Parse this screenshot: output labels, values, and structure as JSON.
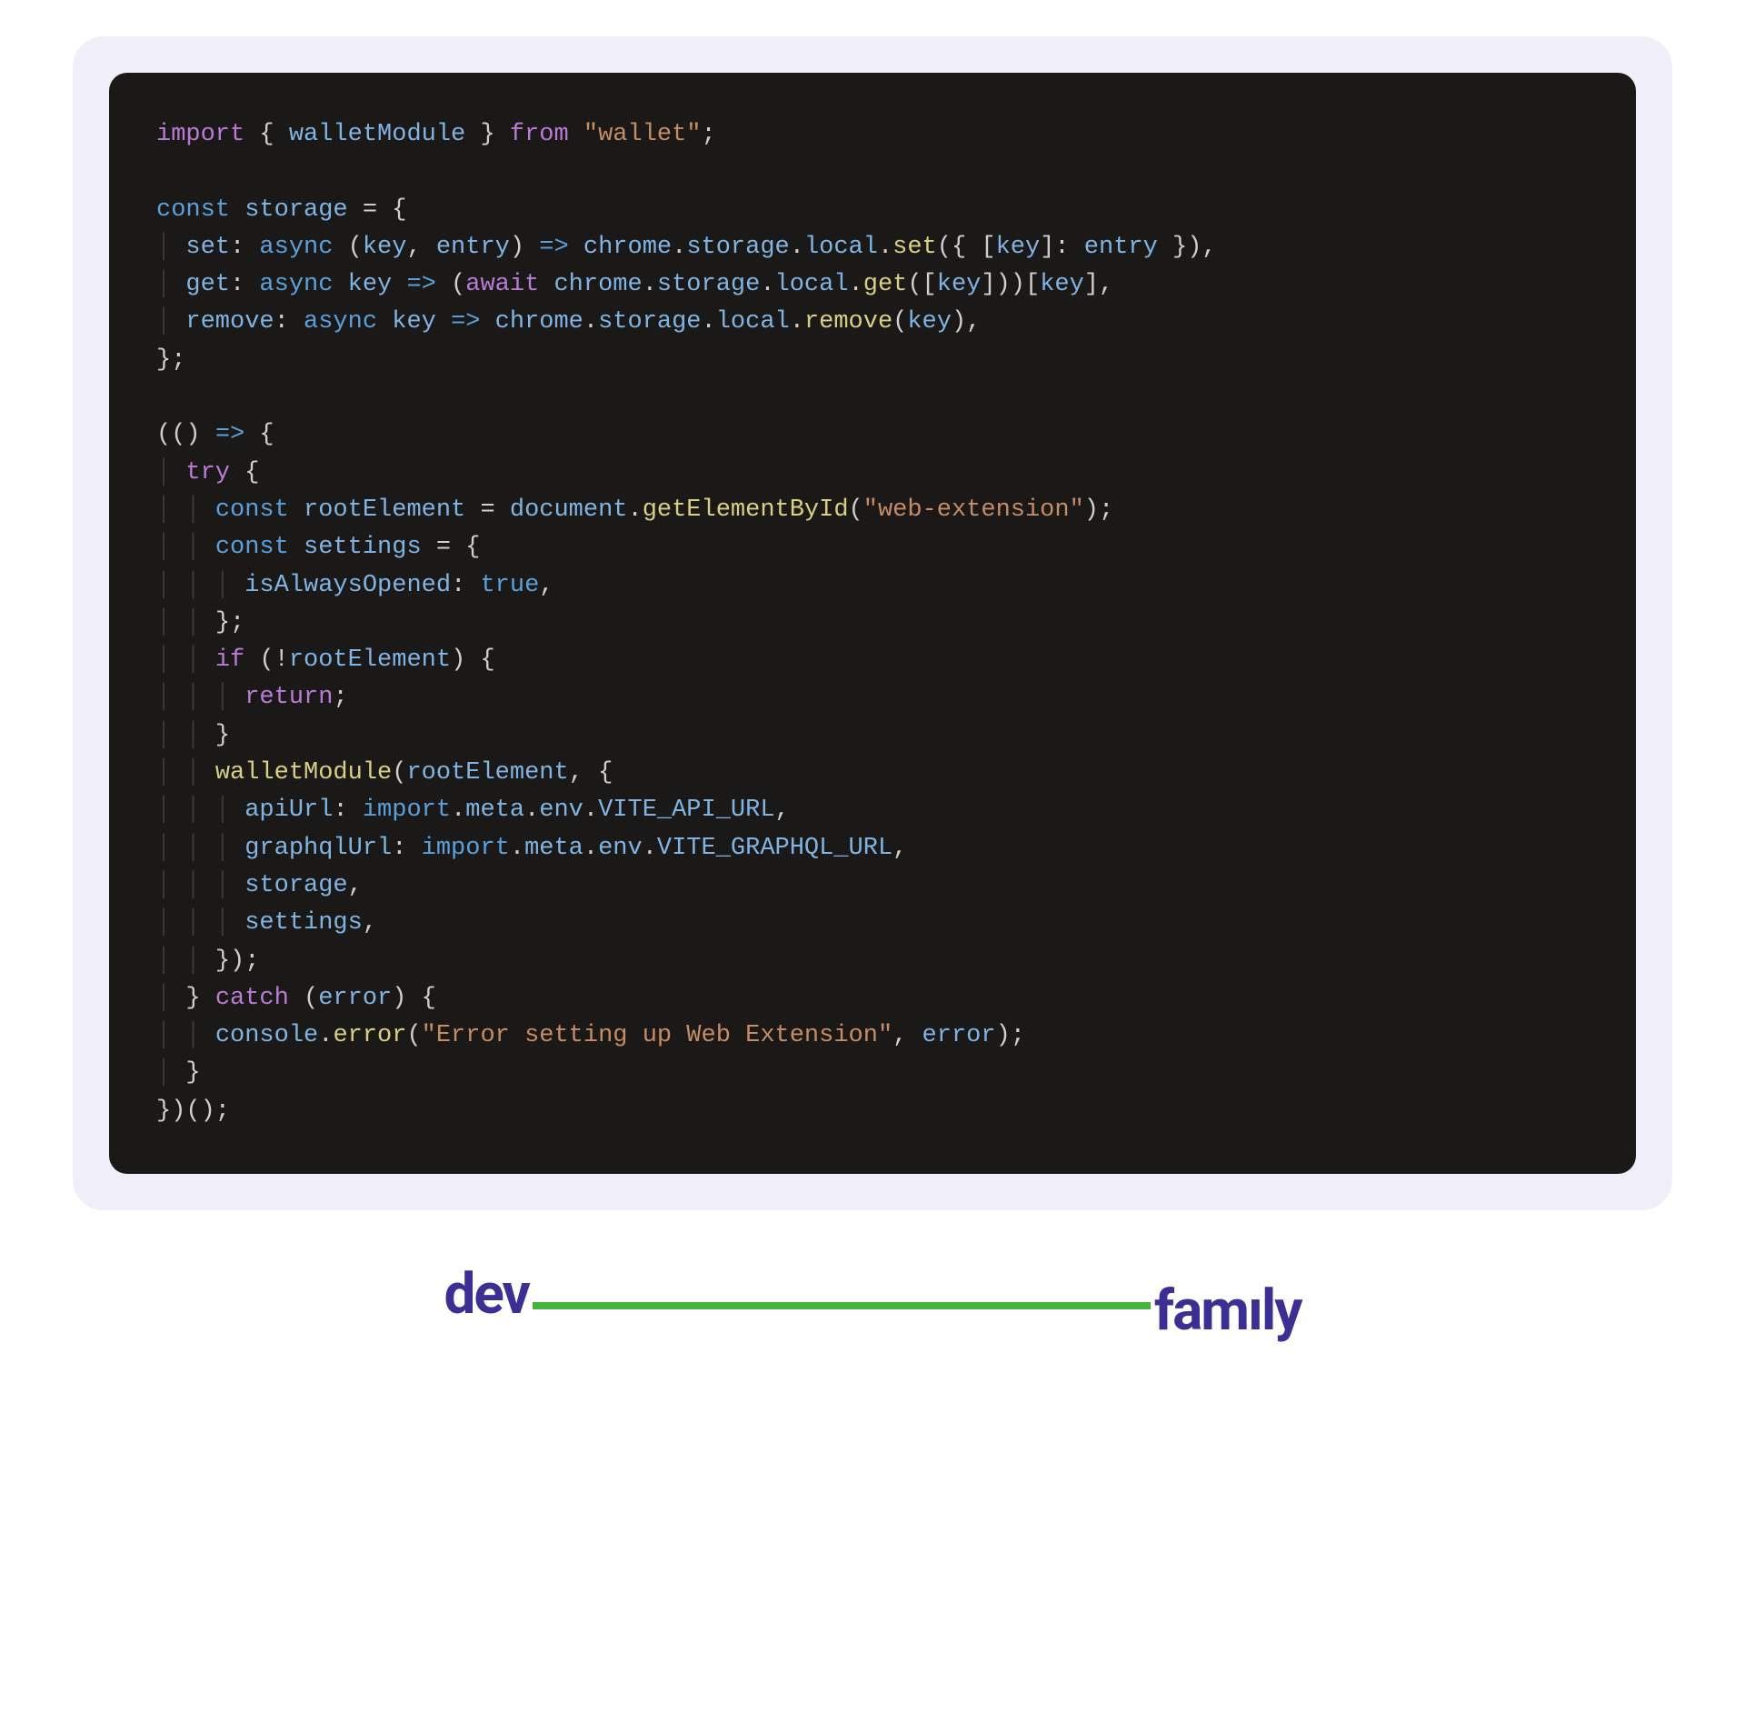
{
  "code": {
    "tokens": [
      [
        [
          "t-purple",
          "import"
        ],
        [
          "t-op",
          " { "
        ],
        [
          "t-lblue",
          "walletModule"
        ],
        [
          "t-op",
          " } "
        ],
        [
          "t-purple",
          "from"
        ],
        [
          "t-op",
          " "
        ],
        [
          "t-string",
          "\"wallet\""
        ],
        [
          "t-op",
          ";"
        ]
      ],
      [],
      [
        [
          "t-blue",
          "const"
        ],
        [
          "t-op",
          " "
        ],
        [
          "t-lblue",
          "storage"
        ],
        [
          "t-op",
          " = {"
        ]
      ],
      [
        [
          "indent-guide",
          "│ "
        ],
        [
          "t-lblue",
          "set"
        ],
        [
          "t-op",
          ": "
        ],
        [
          "t-blue",
          "async"
        ],
        [
          "t-op",
          " ("
        ],
        [
          "t-lblue",
          "key"
        ],
        [
          "t-op",
          ", "
        ],
        [
          "t-lblue",
          "entry"
        ],
        [
          "t-op",
          ") "
        ],
        [
          "t-blue",
          "=>"
        ],
        [
          "t-op",
          " "
        ],
        [
          "t-lblue",
          "chrome"
        ],
        [
          "t-op",
          "."
        ],
        [
          "t-lblue",
          "storage"
        ],
        [
          "t-op",
          "."
        ],
        [
          "t-lblue",
          "local"
        ],
        [
          "t-op",
          "."
        ],
        [
          "t-fn",
          "set"
        ],
        [
          "t-op",
          "({ ["
        ],
        [
          "t-lblue",
          "key"
        ],
        [
          "t-op",
          "]: "
        ],
        [
          "t-lblue",
          "entry"
        ],
        [
          "t-op",
          " }),"
        ]
      ],
      [
        [
          "indent-guide",
          "│ "
        ],
        [
          "t-lblue",
          "get"
        ],
        [
          "t-op",
          ": "
        ],
        [
          "t-blue",
          "async"
        ],
        [
          "t-op",
          " "
        ],
        [
          "t-lblue",
          "key"
        ],
        [
          "t-op",
          " "
        ],
        [
          "t-blue",
          "=>"
        ],
        [
          "t-op",
          " ("
        ],
        [
          "t-purple",
          "await"
        ],
        [
          "t-op",
          " "
        ],
        [
          "t-lblue",
          "chrome"
        ],
        [
          "t-op",
          "."
        ],
        [
          "t-lblue",
          "storage"
        ],
        [
          "t-op",
          "."
        ],
        [
          "t-lblue",
          "local"
        ],
        [
          "t-op",
          "."
        ],
        [
          "t-fn",
          "get"
        ],
        [
          "t-op",
          "(["
        ],
        [
          "t-lblue",
          "key"
        ],
        [
          "t-op",
          "]))["
        ],
        [
          "t-lblue",
          "key"
        ],
        [
          "t-op",
          "],"
        ]
      ],
      [
        [
          "indent-guide",
          "│ "
        ],
        [
          "t-lblue",
          "remove"
        ],
        [
          "t-op",
          ": "
        ],
        [
          "t-blue",
          "async"
        ],
        [
          "t-op",
          " "
        ],
        [
          "t-lblue",
          "key"
        ],
        [
          "t-op",
          " "
        ],
        [
          "t-blue",
          "=>"
        ],
        [
          "t-op",
          " "
        ],
        [
          "t-lblue",
          "chrome"
        ],
        [
          "t-op",
          "."
        ],
        [
          "t-lblue",
          "storage"
        ],
        [
          "t-op",
          "."
        ],
        [
          "t-lblue",
          "local"
        ],
        [
          "t-op",
          "."
        ],
        [
          "t-fn",
          "remove"
        ],
        [
          "t-op",
          "("
        ],
        [
          "t-lblue",
          "key"
        ],
        [
          "t-op",
          "),"
        ]
      ],
      [
        [
          "t-op",
          "};"
        ]
      ],
      [],
      [
        [
          "t-op",
          "(() "
        ],
        [
          "t-blue",
          "=>"
        ],
        [
          "t-op",
          " {"
        ]
      ],
      [
        [
          "indent-guide",
          "│ "
        ],
        [
          "t-purple",
          "try"
        ],
        [
          "t-op",
          " {"
        ]
      ],
      [
        [
          "indent-guide",
          "│ │ "
        ],
        [
          "t-blue",
          "const"
        ],
        [
          "t-op",
          " "
        ],
        [
          "t-lblue",
          "rootElement"
        ],
        [
          "t-op",
          " = "
        ],
        [
          "t-lblue",
          "document"
        ],
        [
          "t-op",
          "."
        ],
        [
          "t-fn",
          "getElementById"
        ],
        [
          "t-op",
          "("
        ],
        [
          "t-string",
          "\"web-extension\""
        ],
        [
          "t-op",
          ");"
        ]
      ],
      [
        [
          "indent-guide",
          "│ │ "
        ],
        [
          "t-blue",
          "const"
        ],
        [
          "t-op",
          " "
        ],
        [
          "t-lblue",
          "settings"
        ],
        [
          "t-op",
          " = {"
        ]
      ],
      [
        [
          "indent-guide",
          "│ │ │ "
        ],
        [
          "t-lblue",
          "isAlwaysOpened"
        ],
        [
          "t-op",
          ": "
        ],
        [
          "t-blue",
          "true"
        ],
        [
          "t-op",
          ","
        ]
      ],
      [
        [
          "indent-guide",
          "│ │ "
        ],
        [
          "t-op",
          "};"
        ]
      ],
      [
        [
          "indent-guide",
          "│ │ "
        ],
        [
          "t-purple",
          "if"
        ],
        [
          "t-op",
          " (!"
        ],
        [
          "t-lblue",
          "rootElement"
        ],
        [
          "t-op",
          ") {"
        ]
      ],
      [
        [
          "indent-guide",
          "│ │ │ "
        ],
        [
          "t-purple",
          "return"
        ],
        [
          "t-op",
          ";"
        ]
      ],
      [
        [
          "indent-guide",
          "│ │ "
        ],
        [
          "t-op",
          "}"
        ]
      ],
      [
        [
          "indent-guide",
          "│ │ "
        ],
        [
          "t-fn",
          "walletModule"
        ],
        [
          "t-op",
          "("
        ],
        [
          "t-lblue",
          "rootElement"
        ],
        [
          "t-op",
          ", {"
        ]
      ],
      [
        [
          "indent-guide",
          "│ │ │ "
        ],
        [
          "t-lblue",
          "apiUrl"
        ],
        [
          "t-op",
          ": "
        ],
        [
          "t-blue",
          "import"
        ],
        [
          "t-op",
          "."
        ],
        [
          "t-lblue",
          "meta"
        ],
        [
          "t-op",
          "."
        ],
        [
          "t-lblue",
          "env"
        ],
        [
          "t-op",
          "."
        ],
        [
          "t-lblue",
          "VITE_API_URL"
        ],
        [
          "t-op",
          ","
        ]
      ],
      [
        [
          "indent-guide",
          "│ │ │ "
        ],
        [
          "t-lblue",
          "graphqlUrl"
        ],
        [
          "t-op",
          ": "
        ],
        [
          "t-blue",
          "import"
        ],
        [
          "t-op",
          "."
        ],
        [
          "t-lblue",
          "meta"
        ],
        [
          "t-op",
          "."
        ],
        [
          "t-lblue",
          "env"
        ],
        [
          "t-op",
          "."
        ],
        [
          "t-lblue",
          "VITE_GRAPHQL_URL"
        ],
        [
          "t-op",
          ","
        ]
      ],
      [
        [
          "indent-guide",
          "│ │ │ "
        ],
        [
          "t-lblue",
          "storage"
        ],
        [
          "t-op",
          ","
        ]
      ],
      [
        [
          "indent-guide",
          "│ │ │ "
        ],
        [
          "t-lblue",
          "settings"
        ],
        [
          "t-op",
          ","
        ]
      ],
      [
        [
          "indent-guide",
          "│ │ "
        ],
        [
          "t-op",
          "});"
        ]
      ],
      [
        [
          "indent-guide",
          "│ "
        ],
        [
          "t-op",
          "} "
        ],
        [
          "t-purple",
          "catch"
        ],
        [
          "t-op",
          " ("
        ],
        [
          "t-lblue",
          "error"
        ],
        [
          "t-op",
          ") {"
        ]
      ],
      [
        [
          "indent-guide",
          "│ │ "
        ],
        [
          "t-lblue",
          "console"
        ],
        [
          "t-op",
          "."
        ],
        [
          "t-fn",
          "error"
        ],
        [
          "t-op",
          "("
        ],
        [
          "t-string",
          "\"Error setting up Web Extension\""
        ],
        [
          "t-op",
          ", "
        ],
        [
          "t-lblue",
          "error"
        ],
        [
          "t-op",
          ");"
        ]
      ],
      [
        [
          "indent-guide",
          "│ "
        ],
        [
          "t-op",
          "}"
        ]
      ],
      [
        [
          "t-op",
          "})();"
        ]
      ]
    ]
  },
  "logo": {
    "dev": "dev",
    "family": "famıly"
  }
}
